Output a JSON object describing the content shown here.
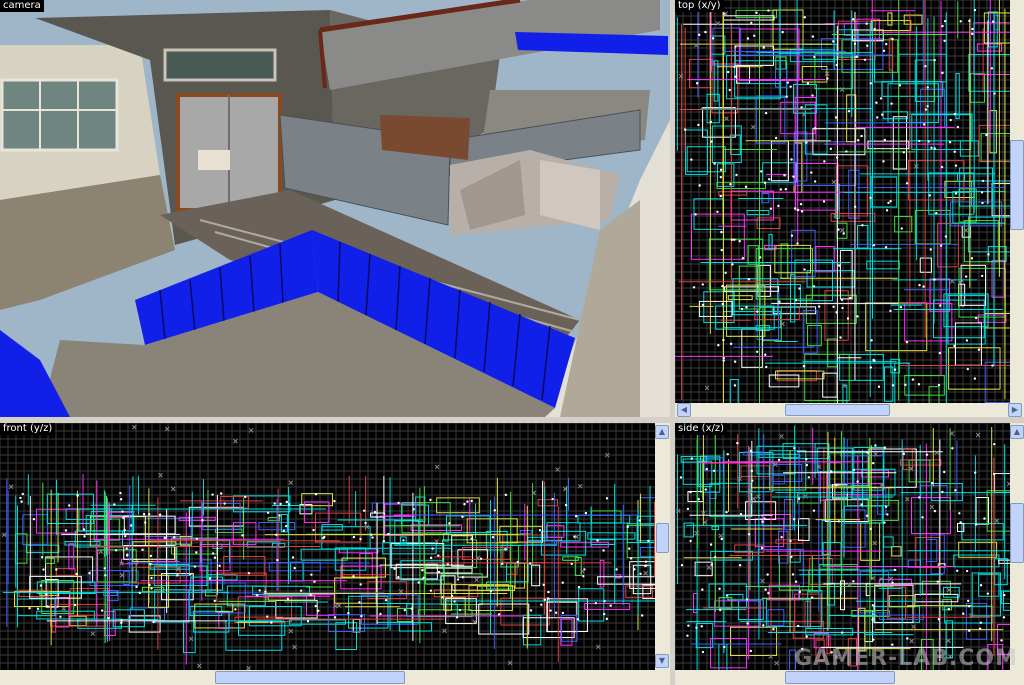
{
  "viewports": {
    "camera": {
      "label": "camera"
    },
    "top": {
      "label": "top (x/y)"
    },
    "front": {
      "label": "front (y/z)"
    },
    "side": {
      "label": "side (x/z)"
    }
  },
  "watermark": "GAMER-LAB.COM",
  "colors": {
    "grid": "#3a3a3a",
    "brush_cyan": "#00e0e0",
    "brush_magenta": "#ff30ff",
    "brush_yellow": "#e0e040",
    "brush_green": "#40e040",
    "brush_white": "#ffffff",
    "brush_blue": "#4060ff",
    "brush_red": "#e04040",
    "wall_blue": "#1020e8",
    "sky": "#9fb6c9"
  },
  "icons": {
    "scroll_up": "▲",
    "scroll_down": "▼",
    "scroll_left": "◀",
    "scroll_right": "▶"
  }
}
